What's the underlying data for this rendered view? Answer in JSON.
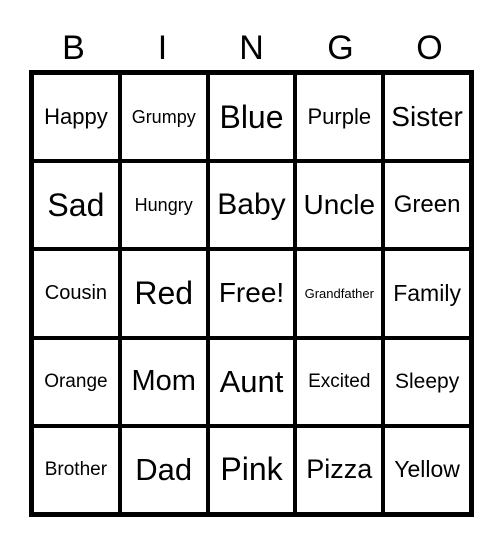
{
  "header": [
    "B",
    "I",
    "N",
    "G",
    "O"
  ],
  "cells": [
    {
      "text": "Happy",
      "size": 22
    },
    {
      "text": "Grumpy",
      "size": 18
    },
    {
      "text": "Blue",
      "size": 32
    },
    {
      "text": "Purple",
      "size": 22
    },
    {
      "text": "Sister",
      "size": 28
    },
    {
      "text": "Sad",
      "size": 32
    },
    {
      "text": "Hungry",
      "size": 18
    },
    {
      "text": "Baby",
      "size": 30
    },
    {
      "text": "Uncle",
      "size": 28
    },
    {
      "text": "Green",
      "size": 24
    },
    {
      "text": "Cousin",
      "size": 20
    },
    {
      "text": "Red",
      "size": 32
    },
    {
      "text": "Free!",
      "size": 28
    },
    {
      "text": "Grandfather",
      "size": 13
    },
    {
      "text": "Family",
      "size": 23
    },
    {
      "text": "Orange",
      "size": 19
    },
    {
      "text": "Mom",
      "size": 29
    },
    {
      "text": "Aunt",
      "size": 31
    },
    {
      "text": "Excited",
      "size": 19
    },
    {
      "text": "Sleepy",
      "size": 21
    },
    {
      "text": "Brother",
      "size": 19
    },
    {
      "text": "Dad",
      "size": 31
    },
    {
      "text": "Pink",
      "size": 32
    },
    {
      "text": "Pizza",
      "size": 27
    },
    {
      "text": "Yellow",
      "size": 23
    }
  ]
}
